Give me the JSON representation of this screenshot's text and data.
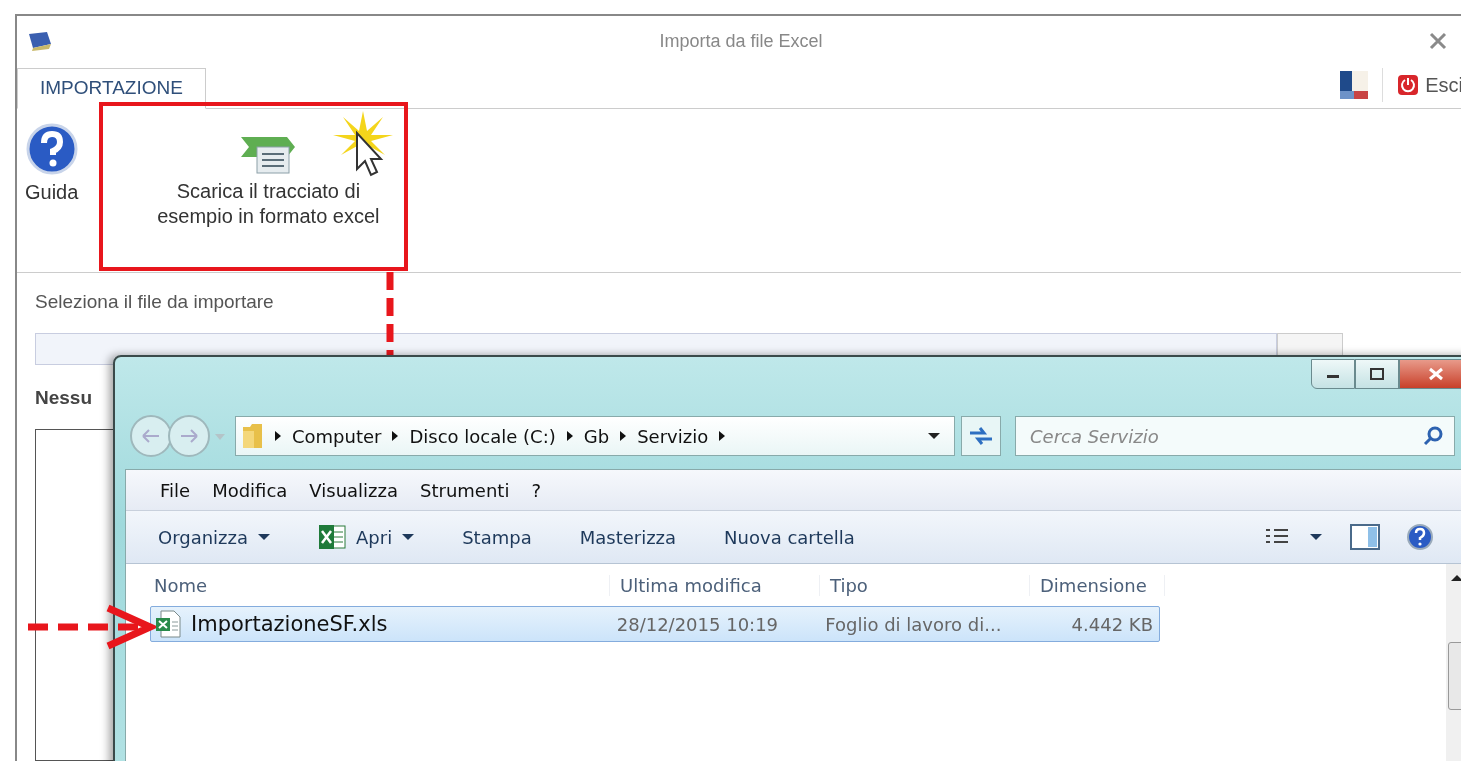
{
  "window": {
    "title": "Importa da file Excel"
  },
  "tabs": [
    {
      "label": "IMPORTAZIONE",
      "selected": true
    }
  ],
  "exit_button": {
    "label": "Esci"
  },
  "ribbon": [
    {
      "kind": "help",
      "label": "Guida"
    },
    {
      "kind": "download",
      "label": "Scarica il tracciato di esempio in formato excel"
    }
  ],
  "file_select": {
    "label": "Seleziona il file da importare",
    "status": "Nessu"
  },
  "explorer": {
    "breadcrumb": [
      "Computer",
      "Disco locale (C:)",
      "Gb",
      "Servizio"
    ],
    "search": {
      "placeholder": "Cerca Servizio"
    },
    "menu": [
      "File",
      "Modifica",
      "Visualizza",
      "Strumenti",
      "?"
    ],
    "toolbar": [
      {
        "kind": "plain",
        "label": "Organizza",
        "dropdown": true
      },
      {
        "kind": "excel",
        "label": "Apri",
        "dropdown": true
      },
      {
        "kind": "plain",
        "label": "Stampa",
        "dropdown": false
      },
      {
        "kind": "plain",
        "label": "Masterizza",
        "dropdown": false
      },
      {
        "kind": "plain",
        "label": "Nuova cartella",
        "dropdown": false
      }
    ],
    "columns": [
      "Nome",
      "Ultima modifica",
      "Tipo",
      "Dimensione"
    ],
    "rows": [
      {
        "name": "ImportazioneSF.xls",
        "modified": "28/12/2015 10:19",
        "type": "Foglio di lavoro di...",
        "size": "4.442 KB",
        "selected": true
      }
    ]
  }
}
